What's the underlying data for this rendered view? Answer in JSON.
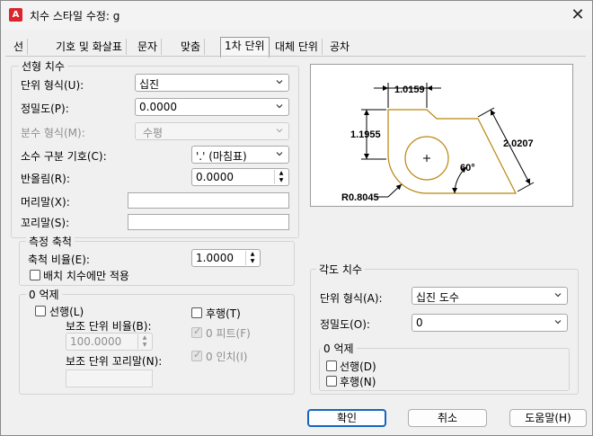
{
  "window": {
    "title": "치수 스타일 수정: g",
    "app_icon_letter": "A",
    "close_glyph": "✕"
  },
  "tabs": [
    {
      "label": "선"
    },
    {
      "label": "기호 및 화살표"
    },
    {
      "label": "문자"
    },
    {
      "label": "맞춤"
    },
    {
      "label": "1차 단위",
      "active": true
    },
    {
      "label": "대체 단위"
    },
    {
      "label": "공차"
    }
  ],
  "linear": {
    "group_title": "선형 치수",
    "unit_format_label": "단위 형식(U):",
    "unit_format_value": "십진",
    "precision_label": "정밀도(P):",
    "precision_value": "0.0000",
    "fraction_label": "분수 형식(M):",
    "fraction_value": "수평",
    "decimal_sep_label": "소수 구분 기호(C):",
    "decimal_sep_value": "'.' (마침표)",
    "round_label": "반올림(R):",
    "round_value": "0.0000",
    "prefix_label": "머리말(X):",
    "prefix_value": "",
    "suffix_label": "꼬리말(S):",
    "suffix_value": ""
  },
  "scale": {
    "group_title": "측정 축척",
    "factor_label": "축척 비율(E):",
    "factor_value": "1.0000",
    "layout_only_label": "배치 치수에만 적용"
  },
  "zero_sup": {
    "group_title": "0 억제",
    "leading_label": "선행(L)",
    "trailing_label": "후행(T)",
    "sub_factor_label": "보조 단위 비율(B):",
    "sub_factor_value": "100.0000",
    "sub_suffix_label": "보조 단위 꼬리말(N):",
    "feet_label": "0 피트(F)",
    "inches_label": "0 인치(I)"
  },
  "preview": {
    "dim_top": "1.0159",
    "dim_left": "1.1955",
    "dim_diag": "2.0207",
    "dim_angle": "60°",
    "dim_radius": "R0.8045",
    "line_color": "#b8860b"
  },
  "angular": {
    "group_title": "각도 치수",
    "unit_format_label": "단위 형식(A):",
    "unit_format_value": "십진 도수",
    "precision_label": "정밀도(O):",
    "precision_value": "0",
    "zero_title": "0 억제",
    "leading_label": "선행(D)",
    "trailing_label": "후행(N)"
  },
  "buttons": {
    "ok": "확인",
    "cancel": "취소",
    "help": "도움말(H)"
  },
  "colors": {
    "accent": "#1565c0",
    "icon_red": "#d9262e"
  }
}
